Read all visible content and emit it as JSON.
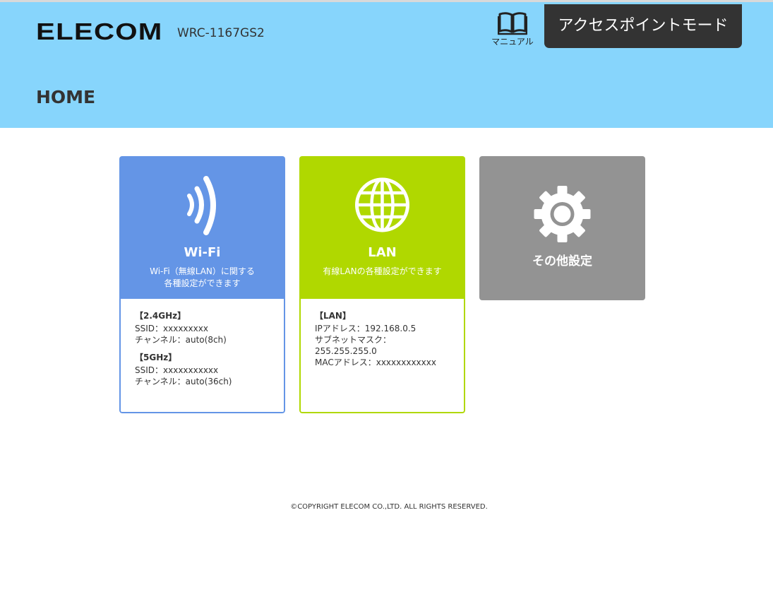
{
  "header": {
    "logo": "ELECOM",
    "model": "WRC-1167GS2",
    "manual_label": "マニュアル",
    "mode_button": "アクセスポイントモード",
    "page_title": "HOME"
  },
  "cards": {
    "wifi": {
      "title": "Wi-Fi",
      "desc_line1": "Wi-Fi（無線LAN）に関する",
      "desc_line2": "各種設定ができます",
      "band1_head": "【2.4GHz】",
      "band1_ssid": "SSID：xxxxxxxxx",
      "band1_channel": "チャンネル：auto(8ch)",
      "band2_head": "【5GHz】",
      "band2_ssid": "SSID：xxxxxxxxxxx",
      "band2_channel": "チャンネル：auto(36ch)"
    },
    "lan": {
      "title": "LAN",
      "desc": "有線LANの各種設定ができます",
      "head": "【LAN】",
      "ip": "IPアドレス：192.168.0.5",
      "subnet_label": "サブネットマスク：",
      "subnet_value": "255.255.255.0",
      "mac": "MACアドレス：xxxxxxxxxxxx"
    },
    "other": {
      "title": "その他設定"
    }
  },
  "footer": {
    "copyright": "©COPYRIGHT ELECOM CO.,LTD. ALL RIGHTS RESERVED."
  },
  "colors": {
    "header_bg": "#87d5fc",
    "wifi": "#6495e6",
    "lan": "#b0d800",
    "other": "#939393",
    "mode_button_bg": "#333333"
  },
  "icons": {
    "manual": "book-icon",
    "wifi": "wifi-signal-icon",
    "lan": "globe-icon",
    "other": "gear-icon"
  }
}
